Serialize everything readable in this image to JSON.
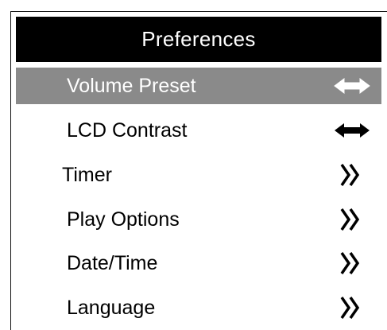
{
  "screen": {
    "title": "Preferences"
  },
  "menu": {
    "items": [
      {
        "label": "Volume Preset",
        "icon": "left-right-arrow-icon",
        "selected": true
      },
      {
        "label": "LCD Contrast",
        "icon": "left-right-arrow-icon",
        "selected": false
      },
      {
        "label": "Timer",
        "icon": "double-chevron-right-icon",
        "selected": false
      },
      {
        "label": "Play Options",
        "icon": "double-chevron-right-icon",
        "selected": false
      },
      {
        "label": "Date/Time",
        "icon": "double-chevron-right-icon",
        "selected": false
      },
      {
        "label": "Language",
        "icon": "double-chevron-right-icon",
        "selected": false
      }
    ]
  },
  "colors": {
    "title_background": "#000000",
    "title_text": "#ffffff",
    "selected_background": "#8a8a8a",
    "selected_text": "#ffffff",
    "text": "#000000"
  }
}
